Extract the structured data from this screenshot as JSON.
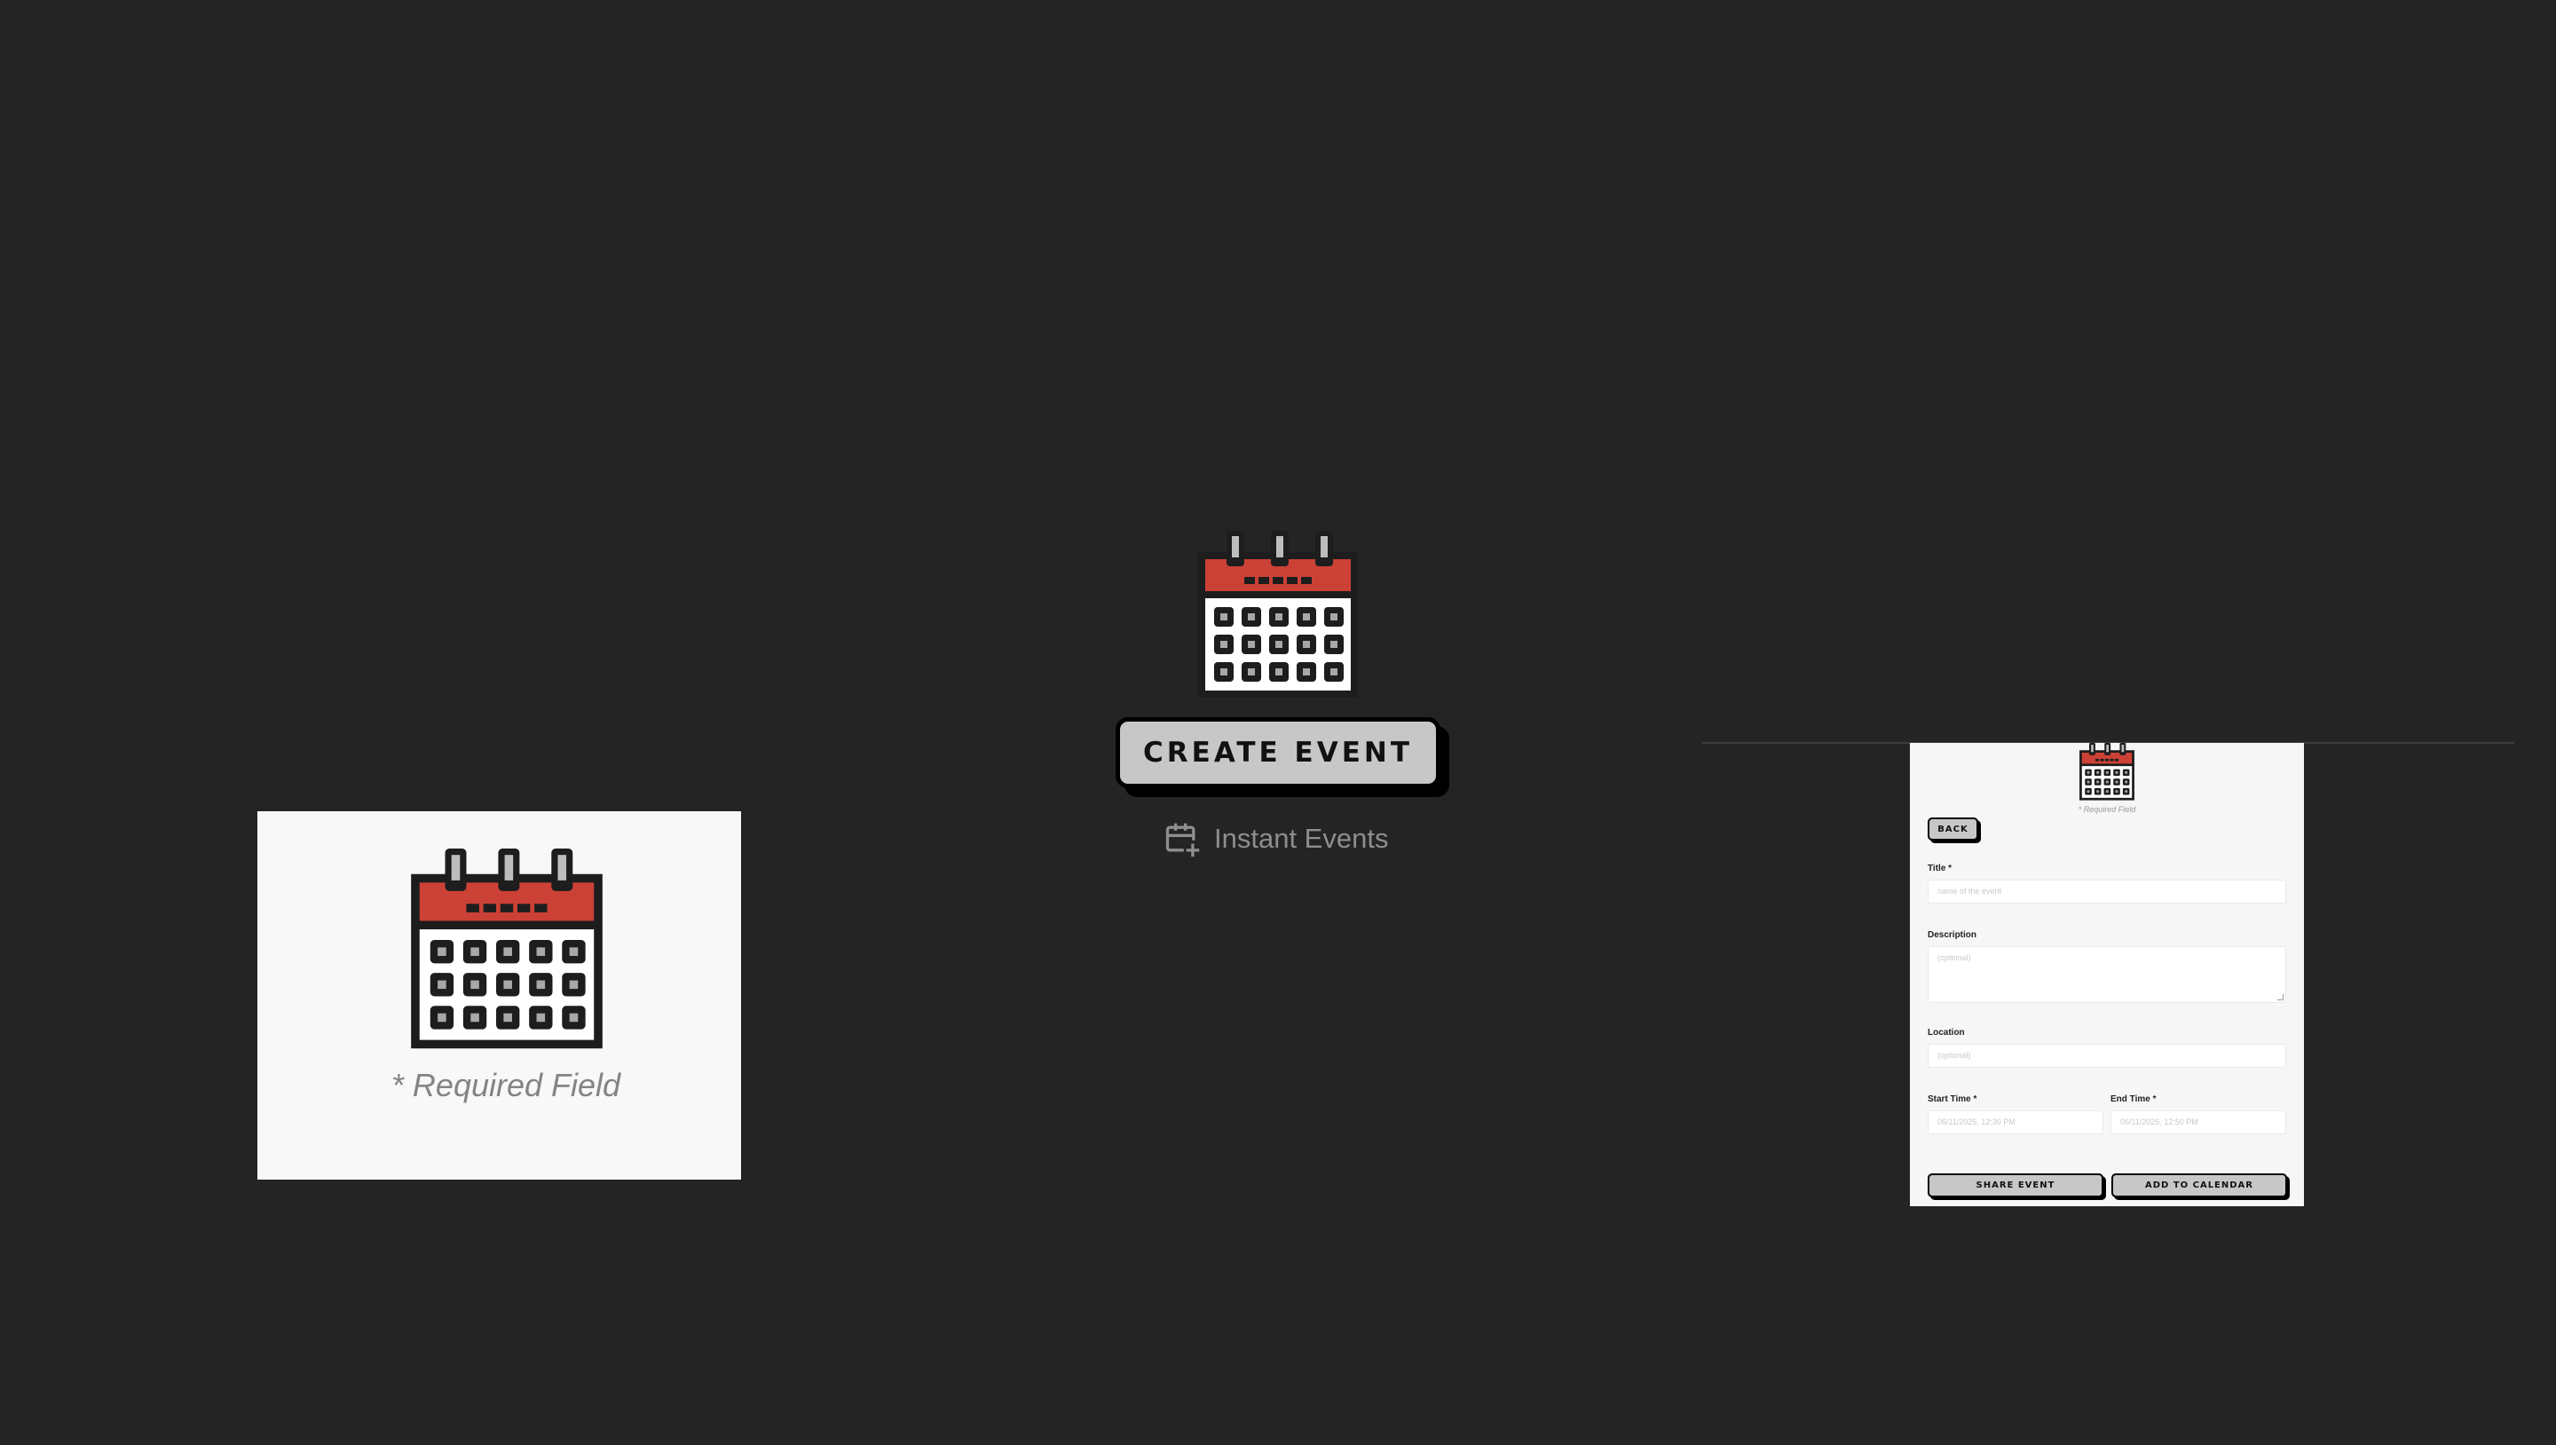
{
  "hero": {
    "create_button_label": "CREATE EVENT",
    "instant_events_label": "Instant Events",
    "icons": [
      "calendar-icon",
      "calendar-add-icon"
    ]
  },
  "left_preview": {
    "required_note": "* Required Field"
  },
  "form": {
    "required_note": "* Required Field",
    "back_label": "BACK",
    "title_label": "Title *",
    "title_placeholder": "name of the event",
    "description_label": "Description",
    "description_placeholder": "(optional)",
    "location_label": "Location",
    "location_placeholder": "(optional)",
    "start_label": "Start Time *",
    "start_value": "06/11/2025, 12:30 PM",
    "end_label": "End Time *",
    "end_value": "06/11/2025, 12:50 PM",
    "share_label": "SHARE EVENT",
    "add_calendar_label": "ADD TO CALENDAR"
  },
  "colors": {
    "background": "#242424",
    "calendar_red": "#cc4136",
    "button_gray": "#c7c7c7",
    "card_background": "#f8f8f8"
  }
}
